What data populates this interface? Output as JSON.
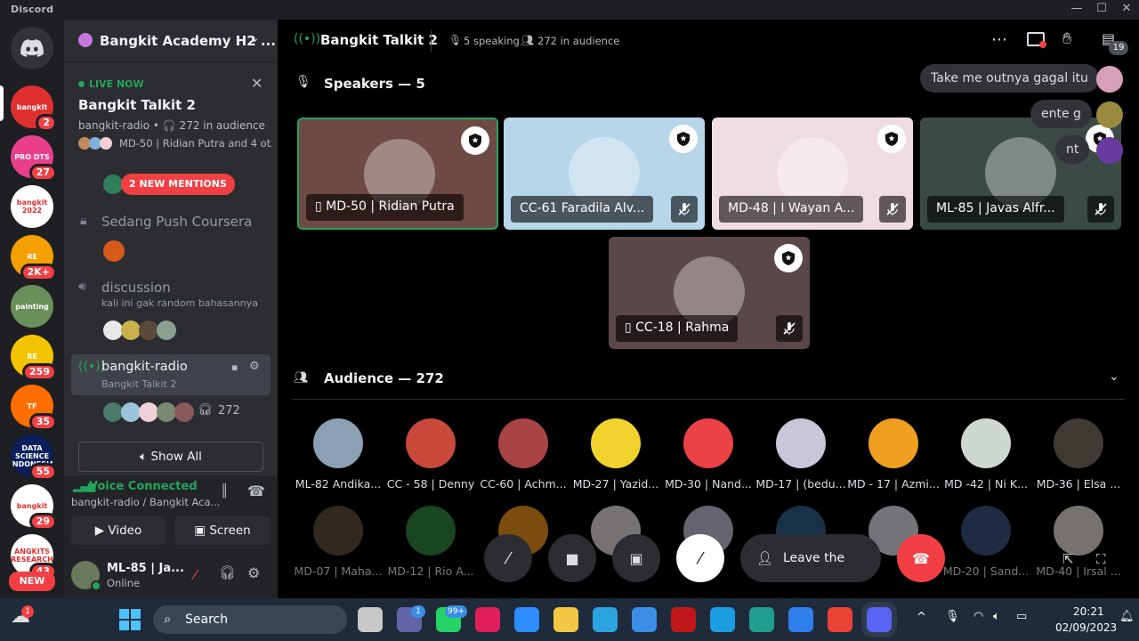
{
  "app": {
    "title": "Discord"
  },
  "servers": [
    {
      "name": "bangkit",
      "badge": "2",
      "color": "#e02f2f"
    },
    {
      "name": "PRO DTS",
      "badge": "27",
      "color": "#e83e8c"
    },
    {
      "name": "bangkit 2022",
      "badge": "",
      "color": "#ffffff"
    },
    {
      "name": "RE",
      "badge": "2K+",
      "color": "#f59f00"
    },
    {
      "name": "painting",
      "badge": "",
      "color": "#6b8f5a"
    },
    {
      "name": "RE",
      "badge": "259",
      "color": "#f5c400"
    },
    {
      "name": "TF",
      "badge": "35",
      "color": "#ff6f00"
    },
    {
      "name": "DATA SCIENCE INDONESIA",
      "badge": "55",
      "color": "#0b1f5c"
    },
    {
      "name": "bangkit",
      "badge": "29",
      "color": "#ffffff"
    },
    {
      "name": "ANGKITS RESEARCH",
      "badge": "43",
      "color": "#ffffff"
    }
  ],
  "rail_new": "NEW",
  "sidebar": {
    "server_name": "Bangkit Academy H2 ...",
    "live_label": "LIVE NOW",
    "stage_title": "Bangkit Talkit 2",
    "stage_meta": "bangkit-radio • 🎧 272 in audience",
    "stage_speakers": "MD-50 | Ridian Putra and 4 ot...",
    "mentions": "2 NEW MENTIONS",
    "channels": [
      {
        "name": "Sedang Push Coursera",
        "sub": ""
      },
      {
        "name": "discussion",
        "sub": "kali ini gak random bahasannya"
      },
      {
        "name": "bangkit-radio",
        "sub": "Bangkit Talkit 2",
        "count": "272"
      }
    ],
    "show_all": "Show All",
    "voice_status": "Voice Connected",
    "voice_channel": "bangkit-radio / Bangkit Aca...",
    "video_label": "Video",
    "screen_label": "Screen",
    "user_name": "ML-85 | Ja...",
    "user_status": "Online"
  },
  "stage": {
    "title": "Bangkit Talkit 2",
    "speaking": "5 speaking",
    "audience_count": "272 in audience",
    "inbox_badge": "19",
    "speakers_heading": "Speakers — 5",
    "audience_heading": "Audience — 272",
    "speakers": [
      {
        "name": "MD-50 | Ridian Putra",
        "bg": "#6e4a44"
      },
      {
        "name": "CC-61 Faradila Alv...",
        "bg": "#b7d6ea"
      },
      {
        "name": "MD-48 | I Wayan A...",
        "bg": "#f0dde2"
      },
      {
        "name": "ML-85 | Javas Alfr...",
        "bg": "#3b4a44"
      },
      {
        "name": "CC-18 | Rahma",
        "bg": "#5b4648"
      }
    ],
    "audience": [
      {
        "name": "ML-82 Andika...",
        "c": "#8aa0b5"
      },
      {
        "name": "CC - 58 | Denny",
        "c": "#c94a3a"
      },
      {
        "name": "CC-60 | Achm...",
        "c": "#a84444"
      },
      {
        "name": "MD-27 | Yazid...",
        "c": "#f2d32e"
      },
      {
        "name": "MD-30 | Nand...",
        "c": "#ed4245"
      },
      {
        "name": "MD-17 | (bedu...",
        "c": "#c9c6d9"
      },
      {
        "name": "MD - 17 | Azmi...",
        "c": "#f0a020"
      },
      {
        "name": "MD -42 | Ni K...",
        "c": "#cfd8cf"
      },
      {
        "name": "MD-36 | Elsa ...",
        "c": "#3f3a34"
      },
      {
        "name": "MD-07 | Maha...",
        "c": "#5a4a3a"
      },
      {
        "name": "MD-12 | Rio A...",
        "c": "#2f7f3a"
      },
      {
        "name": "",
        "c": "#e08a1a"
      },
      {
        "name": "",
        "c": "#d9d2d2"
      },
      {
        "name": "",
        "c": "#b7b7c8"
      },
      {
        "name": "",
        "c": "#2d5a80"
      },
      {
        "name": "",
        "c": "#cfd3d8"
      },
      {
        "name": "MD-20 | Sand...",
        "c": "#3a4e7a"
      },
      {
        "name": "MD-40 | Irsal ...",
        "c": "#d8d0c8"
      }
    ],
    "chat_bubbles": [
      "Take me outnya gagal itu",
      "ente g",
      "nt"
    ],
    "leave_label": "Leave the Stage"
  },
  "taskbar": {
    "search": "Search",
    "time": "20:21",
    "date": "02/09/2023",
    "weather_badge": "1",
    "teams_badge": "1",
    "whatsapp_badge": "99+"
  }
}
